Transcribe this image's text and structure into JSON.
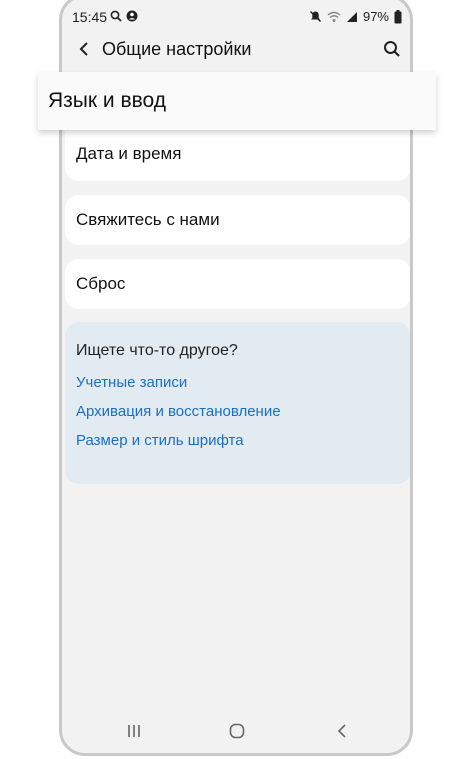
{
  "status_bar": {
    "time": "15:45",
    "battery": "97%"
  },
  "header": {
    "title": "Общие настройки"
  },
  "highlight": {
    "label": "Язык и ввод"
  },
  "items": [
    {
      "label": "Дата и время"
    },
    {
      "label": "Свяжитесь с нами"
    },
    {
      "label": "Сброс"
    }
  ],
  "suggestions": {
    "title": "Ищете что-то другое?",
    "links": [
      {
        "label": "Учетные записи"
      },
      {
        "label": "Архивация и восстановление"
      },
      {
        "label": "Размер и стиль шрифта"
      }
    ]
  },
  "colors": {
    "link": "#1a6fc0",
    "suggest_bg": "#e3ebf2",
    "screen_bg": "#f2f2f2"
  },
  "icons": [
    "search-icon",
    "settings-notification-icon",
    "mute-icon",
    "wifi-icon",
    "signal-icon",
    "battery-icon",
    "back-arrow-icon",
    "recents-icon",
    "home-icon",
    "nav-back-icon"
  ]
}
